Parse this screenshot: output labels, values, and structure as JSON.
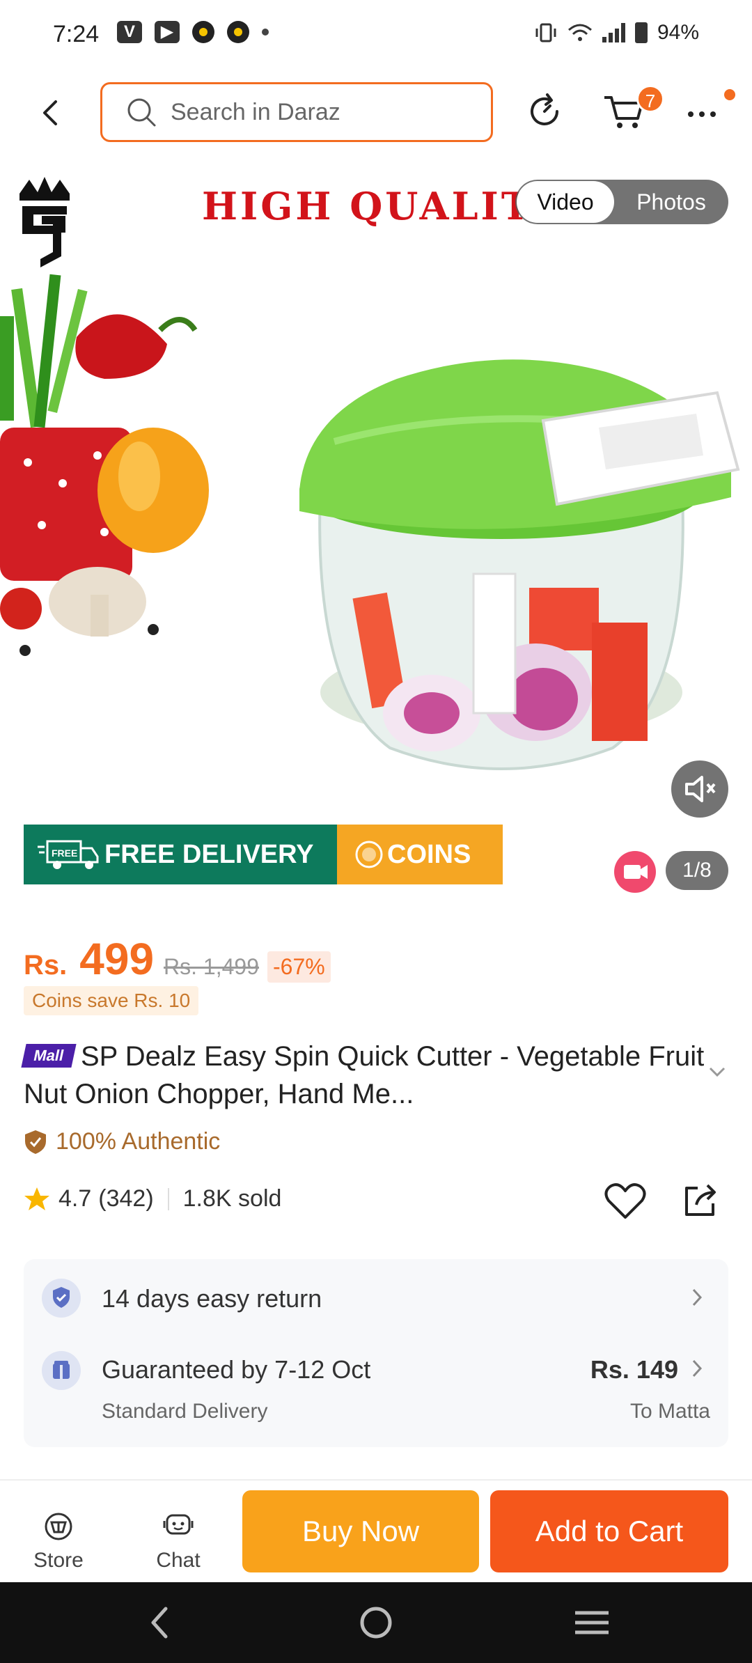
{
  "status_bar": {
    "time": "7:24",
    "battery": "94%",
    "volte": "VoLTE"
  },
  "header": {
    "search_placeholder": "Search in Daraz",
    "cart_count": "7",
    "accent_color": "#f36c20"
  },
  "hero": {
    "headline": "HIGH QUALITY",
    "toggle": {
      "video": "Video",
      "photos": "Photos"
    },
    "promo_free_delivery": "FREE DELIVERY",
    "promo_coins": "COINS",
    "truck_label": "FREE",
    "page_indicator": "1/8"
  },
  "price": {
    "currency": "Rs.",
    "value": "499",
    "original": "Rs. 1,499",
    "discount": "-67%",
    "coins_save": "Coins save Rs. 10"
  },
  "product": {
    "mall_badge": "Mall",
    "title": "SP Dealz Easy Spin Quick Cutter - Vegetable Fruit Nut Onion Chopper, Hand Me...",
    "authentic": "100% Authentic",
    "rating": "4.7",
    "reviews": "(342)",
    "sold": "1.8K sold"
  },
  "services": {
    "return_policy": "14 days easy return",
    "delivery_title": "Guaranteed by 7-12 Oct",
    "delivery_type": "Standard Delivery",
    "delivery_price": "Rs. 149",
    "delivery_location": "To Matta"
  },
  "bottom_bar": {
    "store": "Store",
    "chat": "Chat",
    "buy_now": "Buy Now",
    "add_to_cart": "Add to Cart"
  },
  "icons": [
    "back-icon",
    "search-icon",
    "refresh-icon",
    "cart-icon",
    "more-icon",
    "mute-icon",
    "video-camera-icon",
    "truck-icon",
    "coin-icon",
    "shield-icon",
    "star-icon",
    "heart-icon",
    "share-icon",
    "return-shield-icon",
    "delivery-box-icon",
    "store-icon",
    "chat-icon"
  ]
}
